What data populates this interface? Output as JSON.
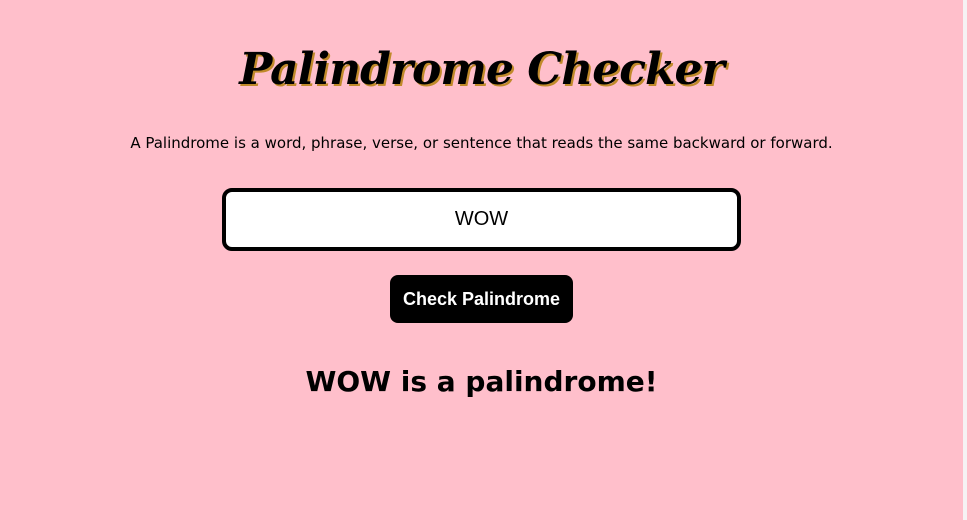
{
  "app": {
    "title": "Palindrome Checker",
    "description": "A Palindrome is a word, phrase, verse, or sentence that reads the same backward or forward."
  },
  "input": {
    "value": "WOW",
    "placeholder": ""
  },
  "button": {
    "label": "Check Palindrome"
  },
  "result": {
    "text": "WOW is a palindrome!"
  },
  "colors": {
    "background": "#ffbfcb",
    "button_bg": "#000000",
    "button_text": "#ffffff",
    "input_border": "#000000",
    "title_shadow": "#c08a2a"
  }
}
